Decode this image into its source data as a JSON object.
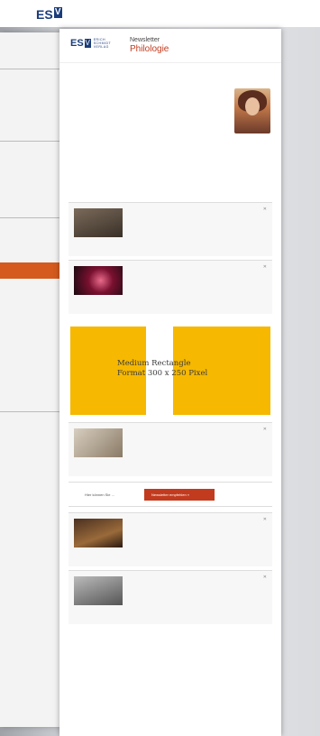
{
  "top_logo": {
    "letters": "ES",
    "mark": "V"
  },
  "brand": {
    "letters": "ES",
    "mark": "V",
    "sub": "ERICH SCHMIDT VERLAG"
  },
  "newsletter": {
    "title": "Newsletter",
    "subtitle": "Philologie"
  },
  "ad": {
    "line1": "Medium Rectangle",
    "line2": "Format 300 x 250 Pixel",
    "color": "#f6b800"
  },
  "cta": {
    "label": "Hier können Sie ...",
    "button": "Newsletter empfehlen »"
  },
  "accent_color": "#c23b1e",
  "brand_color": "#1a3c7a",
  "icons": {
    "close": "close-icon",
    "portrait": "portrait-photo"
  }
}
